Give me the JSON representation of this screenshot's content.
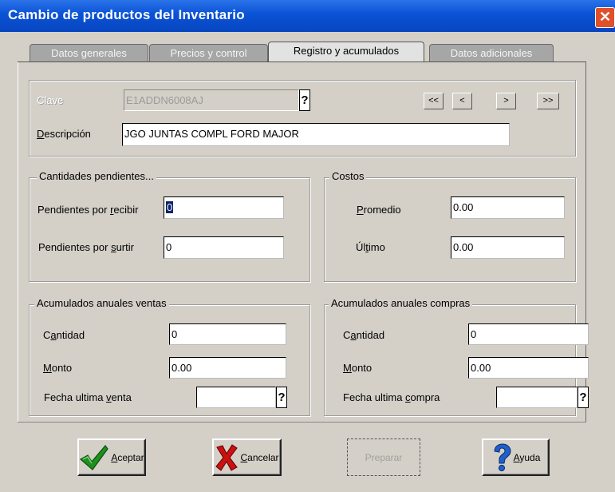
{
  "window": {
    "title": "Cambio de productos del Inventario",
    "close_glyph": "✕"
  },
  "tabs": [
    {
      "label": "Datos generales",
      "active": false
    },
    {
      "label": "Precios y control",
      "active": false
    },
    {
      "label": "Registro y acumulados",
      "active": true
    },
    {
      "label": "Datos adicionales",
      "active": false
    }
  ],
  "record": {
    "clave_label": "Clave",
    "clave_value": "E1ADDN6008AJ",
    "help_glyph": "?",
    "nav": {
      "first": "<<",
      "prev": "<",
      "next": ">",
      "last": ">>"
    },
    "descripcion_label_first": "D",
    "descripcion_label_rest": "escripción",
    "descripcion_value": "JGO JUNTAS COMPL FORD MAJOR"
  },
  "pendientes": {
    "title": "Cantidades pendientes...",
    "recibir_label_pre": "Pendientes por ",
    "recibir_label_u": "r",
    "recibir_label_post": "ecibir",
    "recibir_value": "0",
    "surtir_label_pre": "Pendientes por ",
    "surtir_label_u": "s",
    "surtir_label_post": "urtir",
    "surtir_value": "0"
  },
  "costos": {
    "title": "Costos",
    "promedio_label_u": "P",
    "promedio_label_rest": "romedio",
    "promedio_value": "0.00",
    "ultimo_label_pre": "Úl",
    "ultimo_label_u": "t",
    "ultimo_label_post": "imo",
    "ultimo_value": "0.00"
  },
  "ventas": {
    "title": "Acumulados anuales ventas",
    "cantidad_label_pre": "C",
    "cantidad_label_u": "a",
    "cantidad_label_post": "ntidad",
    "cantidad_value": "0",
    "monto_label_u": "M",
    "monto_label_rest": "onto",
    "monto_value": "0.00",
    "fecha_label_pre": "Fecha ultima ",
    "fecha_label_u": "v",
    "fecha_label_post": "enta",
    "fecha_value": ""
  },
  "compras": {
    "title": "Acumulados anuales compras",
    "cantidad_label_pre": "C",
    "cantidad_label_u": "a",
    "cantidad_label_post": "ntidad",
    "cantidad_value": "0",
    "monto_label_u": "M",
    "monto_label_rest": "onto",
    "monto_value": "0.00",
    "fecha_label_pre": "Fecha ultima ",
    "fecha_label_u": "c",
    "fecha_label_post": "ompra",
    "fecha_value": ""
  },
  "buttons": {
    "aceptar_u": "A",
    "aceptar_rest": "ceptar",
    "cancelar_u": "C",
    "cancelar_rest": "ancelar",
    "preparar": "Preparar",
    "ayuda_u": "A",
    "ayuda_rest": "yuda"
  },
  "colors": {
    "titlebar": "#0a52d6",
    "accept_check": "#1f8f1f",
    "cancel_x": "#cc1010",
    "help_q": "#1f5fc8"
  },
  "icons": [
    "close-icon",
    "check-icon",
    "x-icon",
    "question-icon"
  ]
}
